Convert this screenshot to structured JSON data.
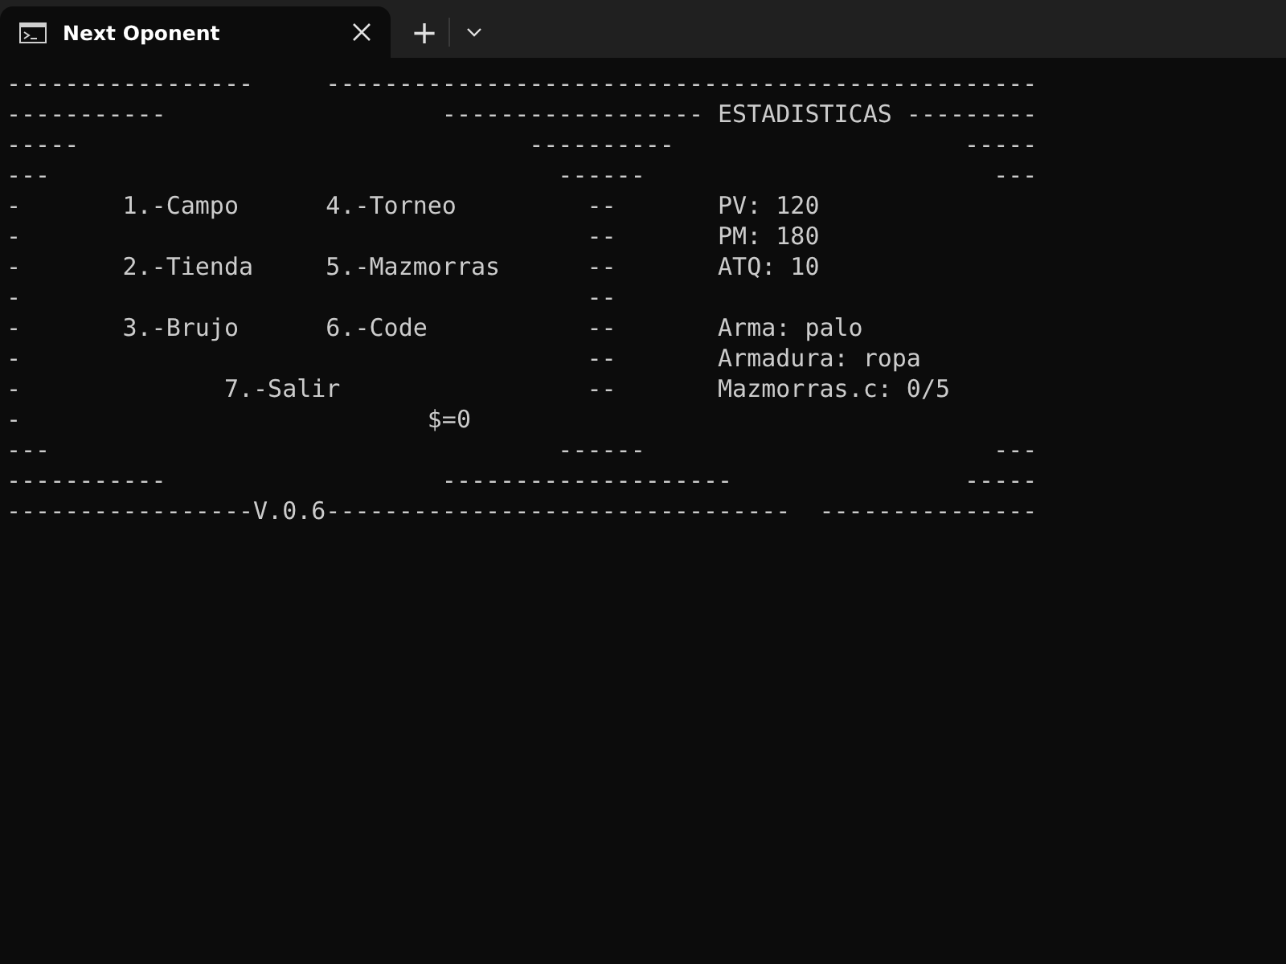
{
  "tab": {
    "title": "Next Oponent",
    "selected": true
  },
  "toolbar": {
    "new_tab": "+"
  },
  "terminal": {
    "lines": [
      "-----------------     -------------------------------------------------",
      "-----------                   ------------------ ESTADISTICAS ---------",
      "-----                               ----------                    -----",
      "---                                   ------                        ---",
      "-       1.-Campo      4.-Torneo         --       PV: 120",
      "-                                       --       PM: 180",
      "-       2.-Tienda     5.-Mazmorras      --       ATQ: 10",
      "-                                       --",
      "-       3.-Brujo      6.-Code           --       Arma: palo",
      "-                                       --       Armadura: ropa",
      "-              7.-Salir                 --       Mazmorras.c: 0/5",
      "-                            $=0",
      "---                                   ------                        ---",
      "-----------                   --------------------                -----",
      "-----------------V.0.6--------------------------------  ---------------"
    ]
  }
}
